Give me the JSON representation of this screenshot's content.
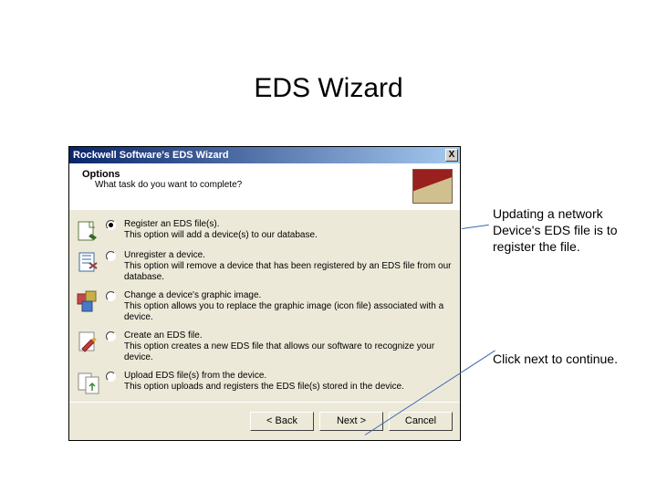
{
  "slide": {
    "title": "EDS Wizard"
  },
  "dialog": {
    "titlebar": "Rockwell Software's EDS Wizard",
    "header": {
      "title": "Options",
      "subtitle": "What task do you want to complete?"
    },
    "options": [
      {
        "label": "Register an EDS file(s).",
        "desc": "This option will add a device(s) to our database.",
        "selected": true
      },
      {
        "label": "Unregister a device.",
        "desc": "This option will remove a device that has been registered by an EDS file from our database.",
        "selected": false
      },
      {
        "label": "Change a device's graphic image.",
        "desc": "This option allows you to replace the graphic image (icon file) associated with a device.",
        "selected": false
      },
      {
        "label": "Create an EDS file.",
        "desc": "This option creates a new EDS file that allows our software to recognize your device.",
        "selected": false
      },
      {
        "label": "Upload EDS file(s) from the device.",
        "desc": "This option uploads and registers the EDS file(s) stored in the device.",
        "selected": false
      }
    ],
    "buttons": {
      "back": "< Back",
      "next": "Next >",
      "cancel": "Cancel"
    }
  },
  "annotations": {
    "a1": "Updating a network Device's EDS file is to register the file.",
    "a2": "Click next to continue."
  },
  "icons": {
    "close": "X"
  }
}
